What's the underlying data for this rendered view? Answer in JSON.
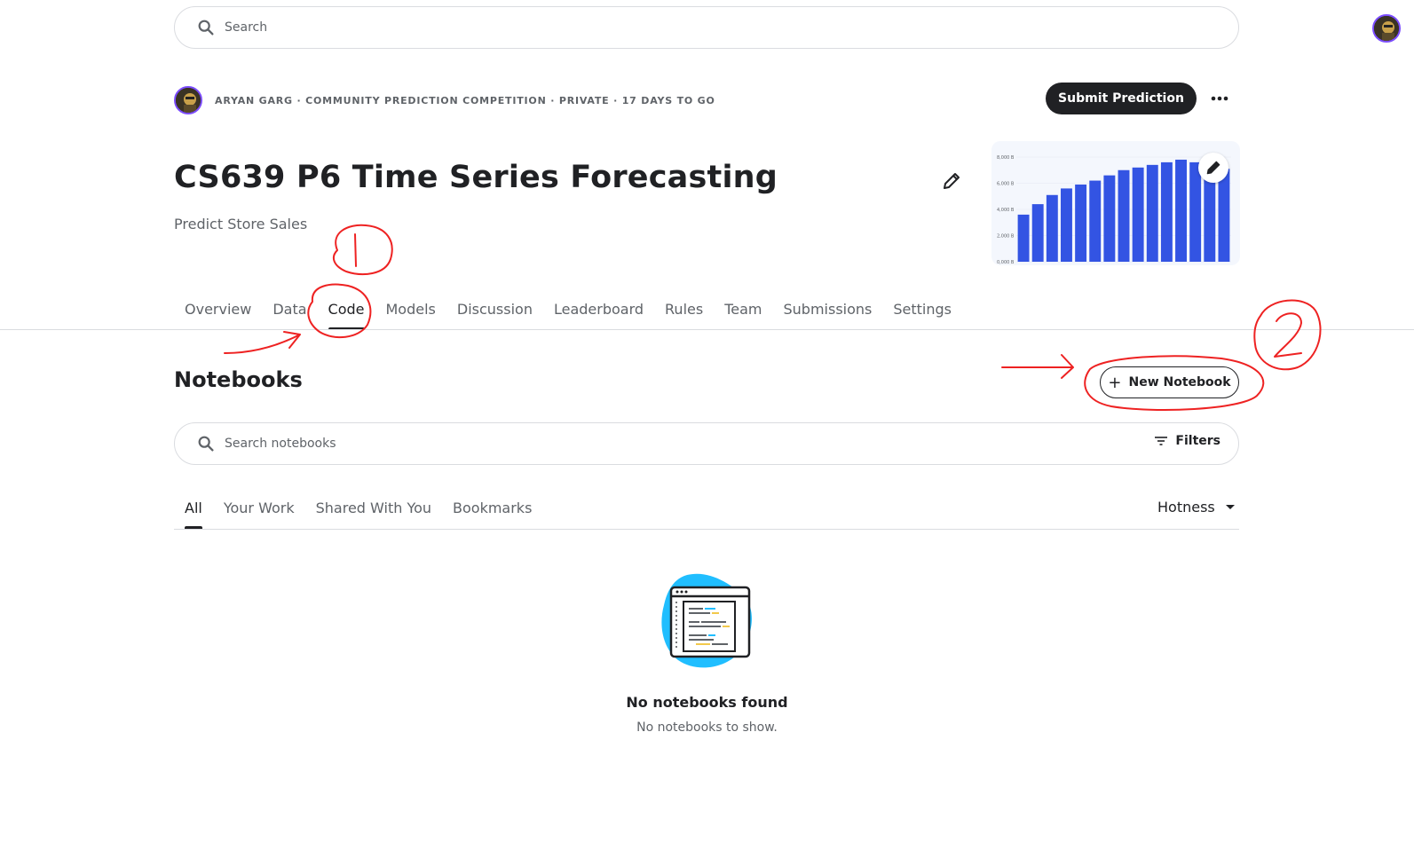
{
  "header": {
    "search_placeholder": "Search",
    "user_avatar": "user-avatar"
  },
  "competition": {
    "meta_line": "ARYAN GARG · COMMUNITY PREDICTION COMPETITION · PRIVATE · 17 DAYS TO GO",
    "submit_label": "Submit Prediction",
    "title": "CS639 P6 Time Series Forecasting",
    "subtitle": "Predict Store Sales",
    "thumbnail_chart": {
      "type": "bar",
      "y_ticks": [
        "8,000 B",
        "6,000 B",
        "4,000 B",
        "2,000 B",
        "0,000 B"
      ],
      "values": [
        3600,
        4400,
        5100,
        5600,
        5900,
        6200,
        6600,
        7000,
        7200,
        7400,
        7600,
        7800,
        7600,
        8000,
        7100
      ],
      "color": "#3354e3",
      "ylim": [
        0,
        8000
      ]
    }
  },
  "tabs": [
    {
      "label": "Overview",
      "active": false
    },
    {
      "label": "Data",
      "active": false
    },
    {
      "label": "Code",
      "active": true
    },
    {
      "label": "Models",
      "active": false
    },
    {
      "label": "Discussion",
      "active": false
    },
    {
      "label": "Leaderboard",
      "active": false
    },
    {
      "label": "Rules",
      "active": false
    },
    {
      "label": "Team",
      "active": false
    },
    {
      "label": "Submissions",
      "active": false
    },
    {
      "label": "Settings",
      "active": false
    }
  ],
  "notebooks": {
    "heading": "Notebooks",
    "new_button": "New Notebook",
    "search_placeholder": "Search notebooks",
    "filters_label": "Filters",
    "sub_tabs": [
      {
        "label": "All",
        "active": true
      },
      {
        "label": "Your Work",
        "active": false
      },
      {
        "label": "Shared With You",
        "active": false
      },
      {
        "label": "Bookmarks",
        "active": false
      }
    ],
    "sort_label": "Hotness",
    "empty_title": "No notebooks found",
    "empty_subtitle": "No notebooks to show."
  },
  "annotations": {
    "color": "#ee2222",
    "marks": [
      "1",
      "2"
    ]
  },
  "colors": {
    "primary_dark": "#202124",
    "muted": "#5f6368",
    "accent_purple": "#7c4dff",
    "illustration_blue": "#20beff"
  }
}
